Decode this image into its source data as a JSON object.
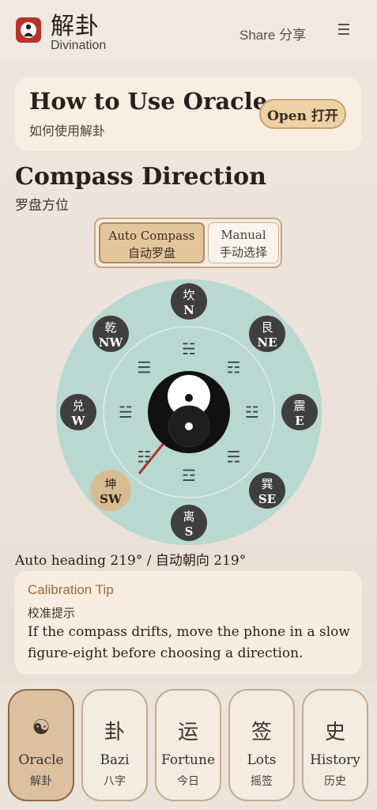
{
  "header": {
    "app_title": "解卦",
    "app_subtitle": "Divination",
    "share_label": "Share 分享"
  },
  "howto": {
    "title": "How to Use Oracle",
    "subtitle": "如何使用解卦",
    "open_label": "Open 打开"
  },
  "compass_section": {
    "title": "Compass Direction",
    "subtitle": "罗盘方位",
    "modes": [
      {
        "label": "Auto Compass",
        "sub": "自动罗盘",
        "selected": true
      },
      {
        "label": "Manual",
        "sub": "手动选择",
        "selected": false
      }
    ],
    "heading_text": "Auto heading 219° / 自动朝向 219°",
    "heading_degrees": 219
  },
  "compass": {
    "ring_color": "#b9d8cf",
    "active_color": "#d7bb91",
    "needle_color": "#b1302a",
    "directions": [
      {
        "trigram": "坎",
        "dir": "N",
        "symbol": "☵",
        "angle": 0,
        "active": false
      },
      {
        "trigram": "艮",
        "dir": "NE",
        "symbol": "☶",
        "angle": 45,
        "active": false
      },
      {
        "trigram": "震",
        "dir": "E",
        "symbol": "☳",
        "angle": 90,
        "active": false
      },
      {
        "trigram": "巽",
        "dir": "SE",
        "symbol": "☴",
        "angle": 135,
        "active": false
      },
      {
        "trigram": "离",
        "dir": "S",
        "symbol": "☲",
        "angle": 180,
        "active": false
      },
      {
        "trigram": "坤",
        "dir": "SW",
        "symbol": "☷",
        "angle": 225,
        "active": true
      },
      {
        "trigram": "兑",
        "dir": "W",
        "symbol": "☱",
        "angle": 270,
        "active": false
      },
      {
        "trigram": "乾",
        "dir": "NW",
        "symbol": "☰",
        "angle": 315,
        "active": false
      }
    ]
  },
  "tip": {
    "title": "Calibration Tip",
    "subtitle": "校准提示",
    "body": "If the compass drifts, move the phone in a slow figure-eight before choosing a direction."
  },
  "tabs": [
    {
      "icon": "☯",
      "label": "Oracle",
      "sub": "解卦",
      "active": true
    },
    {
      "icon": "卦",
      "label": "Bazi",
      "sub": "八字",
      "active": false
    },
    {
      "icon": "运",
      "label": "Fortune",
      "sub": "今日",
      "active": false
    },
    {
      "icon": "签",
      "label": "Lots",
      "sub": "摇签",
      "active": false
    },
    {
      "icon": "史",
      "label": "History",
      "sub": "历史",
      "active": false
    }
  ]
}
